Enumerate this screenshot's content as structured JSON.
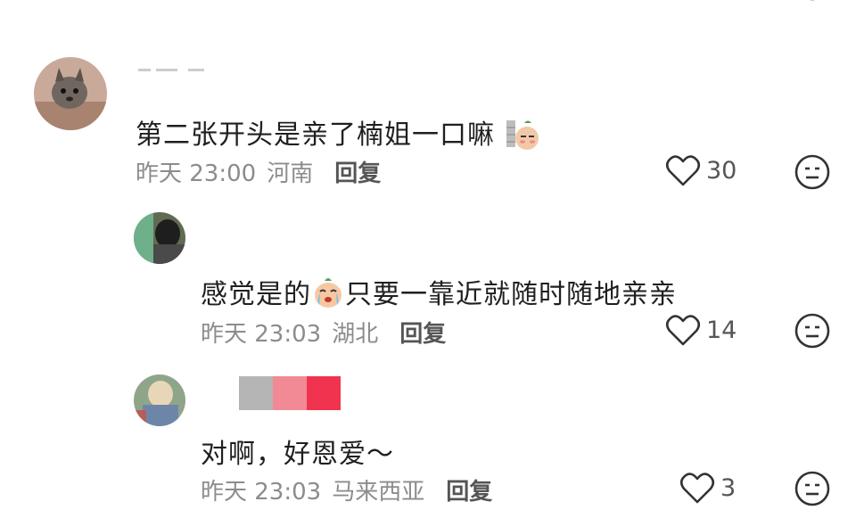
{
  "comments": [
    {
      "text": "第二张开头是亲了楠姐一口嘛",
      "emoji": "shy-peanut-emoji",
      "time": "昨天 23:00",
      "location": "河南",
      "reply_label": "回复",
      "likes": "30"
    },
    {
      "text_before_emoji": "感觉是的",
      "emoji": "crying-peanut-emoji",
      "text_after_emoji": "只要一靠近就随时随地亲亲",
      "time": "昨天 23:03",
      "location": "湖北",
      "reply_label": "回复",
      "likes": "14"
    },
    {
      "text": "对啊，好恩爱～",
      "time": "昨天 23:03",
      "location": "马来西亚",
      "reply_label": "回复",
      "likes": "3"
    }
  ],
  "colors": {
    "meta": "#8c8c8c",
    "text": "#1f1f1f",
    "icon": "#333333",
    "blur_grey": "#b5b5b5",
    "blur_pink": "#f28a96",
    "blur_red": "#f1334f"
  }
}
